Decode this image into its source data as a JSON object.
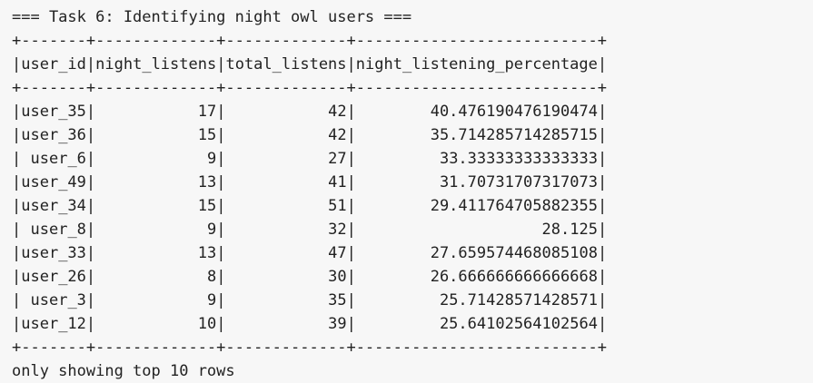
{
  "output": {
    "header": "=== Task 6: Identifying night owl users ===",
    "table": {
      "border": "+-------+-------------+-------------+--------------------------+",
      "columns": [
        "user_id",
        "night_listens",
        "total_listens",
        "night_listening_percentage"
      ],
      "rows": [
        [
          "user_35",
          "17",
          "42",
          "40.476190476190474"
        ],
        [
          "user_36",
          "15",
          "42",
          "35.714285714285715"
        ],
        [
          "user_6",
          "9",
          "27",
          "33.33333333333333"
        ],
        [
          "user_49",
          "13",
          "41",
          "31.70731707317073"
        ],
        [
          "user_34",
          "15",
          "51",
          "29.411764705882355"
        ],
        [
          "user_8",
          "9",
          "32",
          "28.125"
        ],
        [
          "user_33",
          "13",
          "47",
          "27.659574468085108"
        ],
        [
          "user_26",
          "8",
          "30",
          "26.666666666666668"
        ],
        [
          "user_3",
          "9",
          "35",
          "25.71428571428571"
        ],
        [
          "user_12",
          "10",
          "39",
          "25.64102564102564"
        ]
      ]
    },
    "footer": "only showing top 10 rows"
  }
}
